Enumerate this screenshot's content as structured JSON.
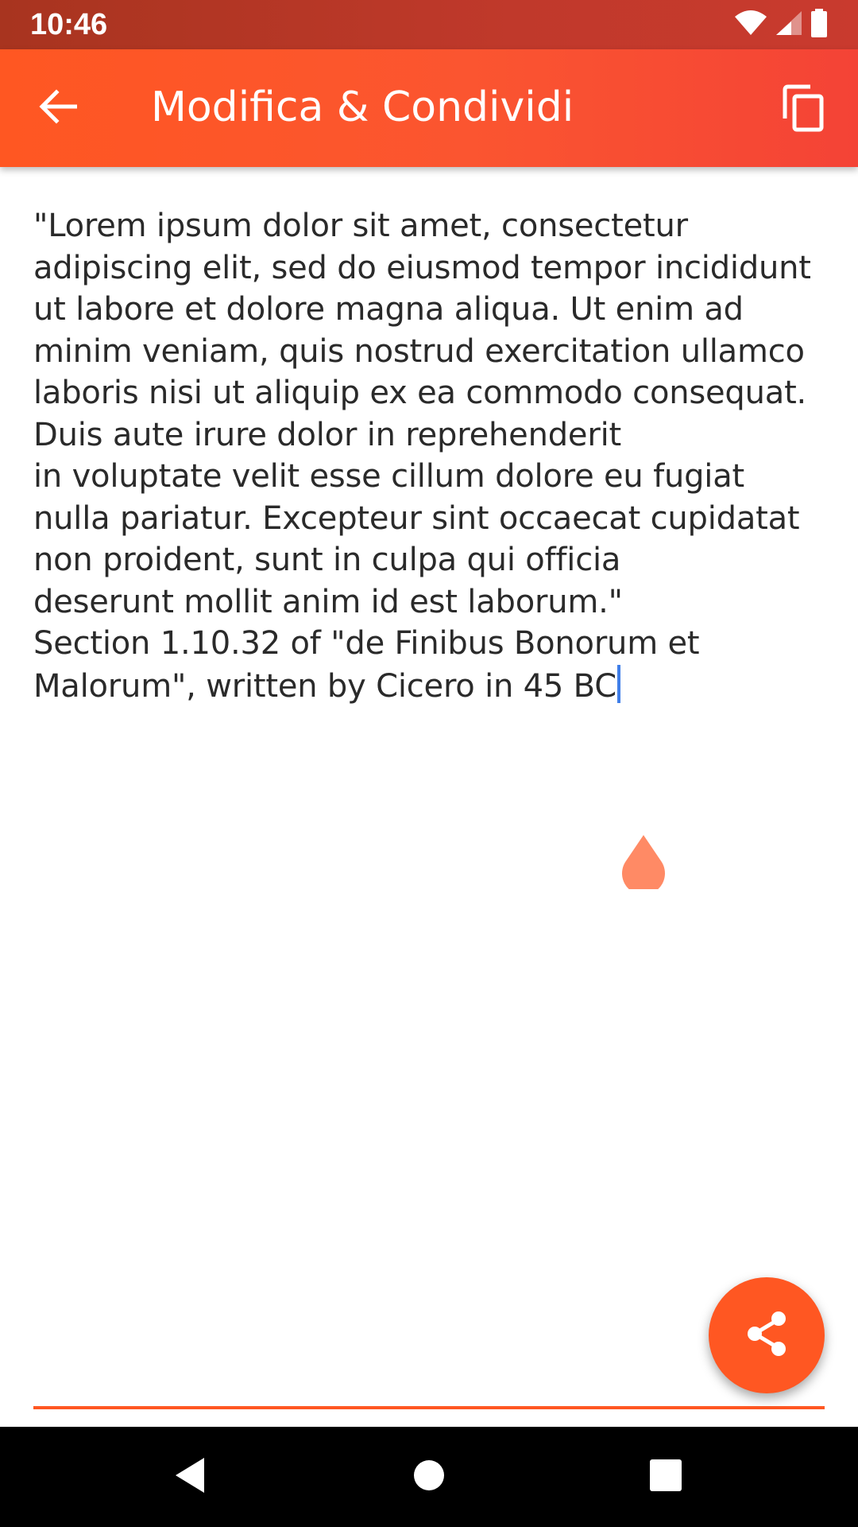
{
  "status_bar": {
    "time": "10:46",
    "icons": [
      "wifi-icon",
      "signal-icon",
      "battery-icon"
    ]
  },
  "app_bar": {
    "title": "Modifica & Condividi",
    "back_icon": "arrow-back-icon",
    "copy_icon": "copy-icon"
  },
  "editor": {
    "text": "\"Lorem ipsum dolor sit amet, consectetur adipiscing elit, sed do eiusmod tempor incididunt ut labore et dolore magna aliqua. Ut enim ad\nminim veniam, quis nostrud exercitation ullamco laboris nisi ut aliquip ex ea commodo consequat. Duis aute irure dolor in reprehenderit\nin voluptate velit esse cillum dolore eu fugiat nulla pariatur. Excepteur sint occaecat cupidatat non proident, sunt in culpa qui officia\ndeserunt mollit anim id est laborum.\"\nSection 1.10.32 of \"de Finibus Bonorum et Malorum\", written by Cicero in 45 BC",
    "cursor_color": "#3f7ee8",
    "handle_color": "#ff8a65"
  },
  "fab": {
    "icon": "share-icon"
  },
  "colors": {
    "accent": "#ff5722",
    "status_bar": "#b83a26"
  },
  "nav_bar": {
    "icons": [
      "back-triangle-icon",
      "home-circle-icon",
      "recents-square-icon"
    ]
  }
}
